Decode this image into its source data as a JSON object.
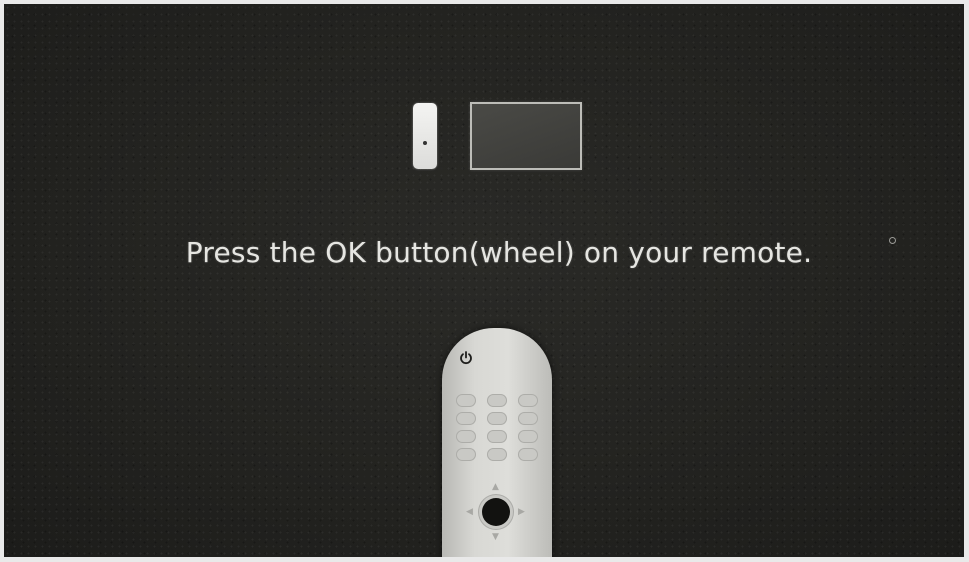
{
  "screen": {
    "instruction": "Press the OK button(wheel) on your remote."
  },
  "illustration": {
    "pairing_icons": [
      "remote-icon",
      "tv-icon"
    ],
    "remote_icons": [
      "power-icon",
      "ok-wheel-button"
    ]
  },
  "colors": {
    "background": "#232320",
    "text": "#e6e6e2",
    "remote_body": "#d8d8d4",
    "ok_wheel": "#121210"
  }
}
